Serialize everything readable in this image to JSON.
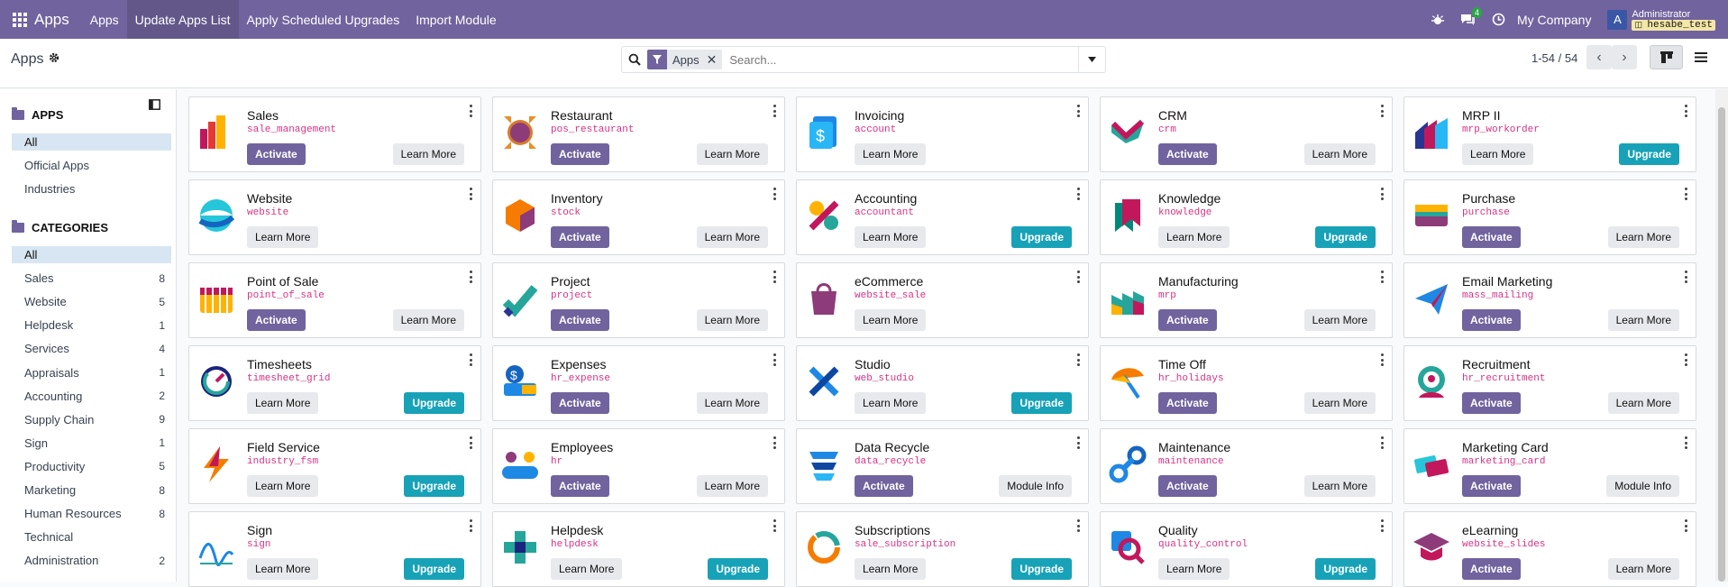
{
  "navbar": {
    "brand": "Apps",
    "menus": [
      "Apps",
      "Update Apps List",
      "Apply Scheduled Upgrades",
      "Import Module"
    ],
    "active_menu": 1,
    "chat_count": "4",
    "company": "My Company",
    "avatar_letter": "A",
    "user_name": "Administrator",
    "db_name": "hesabe_test",
    "bg_color": "#71639e"
  },
  "control": {
    "breadcrumb": "Apps",
    "facet": "Apps",
    "search_placeholder": "Search...",
    "pager": "1-54 / 54"
  },
  "sidebar": {
    "apps_title": "APPS",
    "apps_items": [
      {
        "label": "All",
        "count": "",
        "selected": true
      },
      {
        "label": "Official Apps",
        "count": "",
        "selected": false
      },
      {
        "label": "Industries",
        "count": "",
        "selected": false
      }
    ],
    "categories_title": "CATEGORIES",
    "category_items": [
      {
        "label": "All",
        "count": "",
        "selected": true
      },
      {
        "label": "Sales",
        "count": "8"
      },
      {
        "label": "Website",
        "count": "5"
      },
      {
        "label": "Helpdesk",
        "count": "1"
      },
      {
        "label": "Services",
        "count": "4"
      },
      {
        "label": "Appraisals",
        "count": "1"
      },
      {
        "label": "Accounting",
        "count": "2"
      },
      {
        "label": "Supply Chain",
        "count": "9"
      },
      {
        "label": "Sign",
        "count": "1"
      },
      {
        "label": "Productivity",
        "count": "5"
      },
      {
        "label": "Marketing",
        "count": "8"
      },
      {
        "label": "Human Resources",
        "count": "8"
      },
      {
        "label": "Technical",
        "count": ""
      },
      {
        "label": "Administration",
        "count": "2"
      }
    ]
  },
  "buttons": {
    "activate": "Activate",
    "learn_more": "Learn More",
    "upgrade": "Upgrade",
    "module_info": "Module Info"
  },
  "apps": [
    {
      "name": "Sales",
      "tech": "sale_management",
      "left": "activate",
      "right": "learn_more",
      "icon": "sales-icon"
    },
    {
      "name": "Restaurant",
      "tech": "pos_restaurant",
      "left": "activate",
      "right": "learn_more",
      "icon": "restaurant-icon"
    },
    {
      "name": "Invoicing",
      "tech": "account",
      "left": "learn_more",
      "right": "",
      "icon": "invoicing-icon"
    },
    {
      "name": "CRM",
      "tech": "crm",
      "left": "activate",
      "right": "learn_more",
      "icon": "crm-icon"
    },
    {
      "name": "MRP II",
      "tech": "mrp_workorder",
      "left": "learn_more",
      "right": "upgrade",
      "icon": "mrp-icon"
    },
    {
      "name": "Website",
      "tech": "website",
      "left": "learn_more",
      "right": "",
      "icon": "website-icon"
    },
    {
      "name": "Inventory",
      "tech": "stock",
      "left": "activate",
      "right": "learn_more",
      "icon": "inventory-icon"
    },
    {
      "name": "Accounting",
      "tech": "accountant",
      "left": "learn_more",
      "right": "upgrade",
      "icon": "accounting-icon"
    },
    {
      "name": "Knowledge",
      "tech": "knowledge",
      "left": "learn_more",
      "right": "upgrade",
      "icon": "knowledge-icon"
    },
    {
      "name": "Purchase",
      "tech": "purchase",
      "left": "activate",
      "right": "learn_more",
      "icon": "purchase-icon"
    },
    {
      "name": "Point of Sale",
      "tech": "point_of_sale",
      "left": "activate",
      "right": "learn_more",
      "icon": "point-of-sale-icon"
    },
    {
      "name": "Project",
      "tech": "project",
      "left": "activate",
      "right": "learn_more",
      "icon": "project-icon"
    },
    {
      "name": "eCommerce",
      "tech": "website_sale",
      "left": "learn_more",
      "right": "",
      "icon": "ecommerce-icon"
    },
    {
      "name": "Manufacturing",
      "tech": "mrp",
      "left": "activate",
      "right": "learn_more",
      "icon": "manufacturing-icon"
    },
    {
      "name": "Email Marketing",
      "tech": "mass_mailing",
      "left": "activate",
      "right": "learn_more",
      "icon": "email-marketing-icon"
    },
    {
      "name": "Timesheets",
      "tech": "timesheet_grid",
      "left": "learn_more",
      "right": "upgrade",
      "icon": "timesheets-icon"
    },
    {
      "name": "Expenses",
      "tech": "hr_expense",
      "left": "activate",
      "right": "learn_more",
      "icon": "expenses-icon"
    },
    {
      "name": "Studio",
      "tech": "web_studio",
      "left": "learn_more",
      "right": "upgrade",
      "icon": "studio-icon"
    },
    {
      "name": "Time Off",
      "tech": "hr_holidays",
      "left": "activate",
      "right": "learn_more",
      "icon": "time-off-icon"
    },
    {
      "name": "Recruitment",
      "tech": "hr_recruitment",
      "left": "activate",
      "right": "learn_more",
      "icon": "recruitment-icon"
    },
    {
      "name": "Field Service",
      "tech": "industry_fsm",
      "left": "learn_more",
      "right": "upgrade",
      "icon": "field-service-icon"
    },
    {
      "name": "Employees",
      "tech": "hr",
      "left": "activate",
      "right": "learn_more",
      "icon": "employees-icon"
    },
    {
      "name": "Data Recycle",
      "tech": "data_recycle",
      "left": "activate",
      "right": "module_info",
      "icon": "data-recycle-icon"
    },
    {
      "name": "Maintenance",
      "tech": "maintenance",
      "left": "activate",
      "right": "learn_more",
      "icon": "maintenance-icon"
    },
    {
      "name": "Marketing Card",
      "tech": "marketing_card",
      "left": "activate",
      "right": "module_info",
      "icon": "marketing-card-icon"
    },
    {
      "name": "Sign",
      "tech": "sign",
      "left": "learn_more",
      "right": "upgrade",
      "icon": "sign-icon"
    },
    {
      "name": "Helpdesk",
      "tech": "helpdesk",
      "left": "learn_more",
      "right": "upgrade",
      "icon": "helpdesk-icon"
    },
    {
      "name": "Subscriptions",
      "tech": "sale_subscription",
      "left": "learn_more",
      "right": "upgrade",
      "icon": "subscriptions-icon"
    },
    {
      "name": "Quality",
      "tech": "quality_control",
      "left": "learn_more",
      "right": "upgrade",
      "icon": "quality-icon"
    },
    {
      "name": "eLearning",
      "tech": "website_slides",
      "left": "activate",
      "right": "learn_more",
      "icon": "elearning-icon"
    }
  ]
}
